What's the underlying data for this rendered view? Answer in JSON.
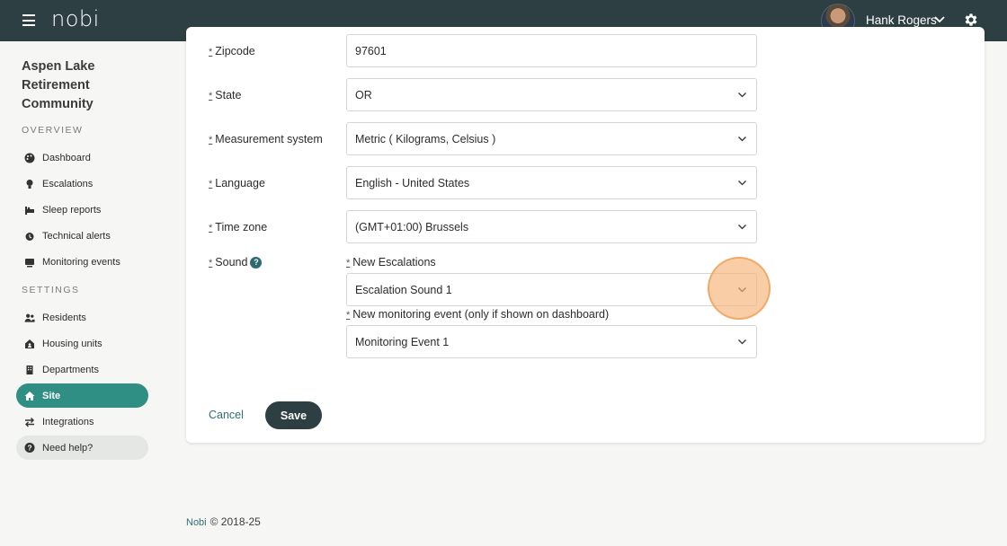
{
  "header": {
    "logo": "nobi",
    "user_name": "Hank Rogers"
  },
  "sidebar": {
    "site_name": "Aspen Lake Retirement Community",
    "overview_label": "OVERVIEW",
    "settings_label": "SETTINGS",
    "overview_items": [
      {
        "label": "Dashboard",
        "icon": "palette-icon"
      },
      {
        "label": "Escalations",
        "icon": "lightbulb-icon"
      },
      {
        "label": "Sleep reports",
        "icon": "bed-icon"
      },
      {
        "label": "Technical alerts",
        "icon": "alarm-icon"
      },
      {
        "label": "Monitoring events",
        "icon": "monitor-icon"
      }
    ],
    "settings_items": [
      {
        "label": "Residents",
        "icon": "users-icon"
      },
      {
        "label": "Housing units",
        "icon": "house-user-icon"
      },
      {
        "label": "Departments",
        "icon": "building-icon"
      },
      {
        "label": "Site",
        "icon": "home-icon",
        "active": true
      },
      {
        "label": "Integrations",
        "icon": "arrows-icon"
      }
    ],
    "help_label": "Need help?"
  },
  "form": {
    "required_mark": "*",
    "zipcode": {
      "label": "Zipcode",
      "value": "97601"
    },
    "state": {
      "label": "State",
      "value": "OR"
    },
    "measurement": {
      "label": "Measurement system",
      "value": "Metric ( Kilograms, Celsius )"
    },
    "language": {
      "label": "Language",
      "value": "English - United States"
    },
    "timezone": {
      "label": "Time zone",
      "value": "(GMT+01:00) Brussels"
    },
    "sound": {
      "label": "Sound",
      "escalations_label": "New Escalations",
      "escalations_value": "Escalation Sound 1",
      "monitoring_label": "New monitoring event (only if shown on dashboard)",
      "monitoring_value": "Monitoring Event 1"
    },
    "cancel_label": "Cancel",
    "save_label": "Save"
  },
  "footer": {
    "brand": "Nobi",
    "copyright": "© 2018-25"
  },
  "colors": {
    "topbar": "#2d3f42",
    "accent": "#2f8f84",
    "highlight": "#f6b376"
  }
}
